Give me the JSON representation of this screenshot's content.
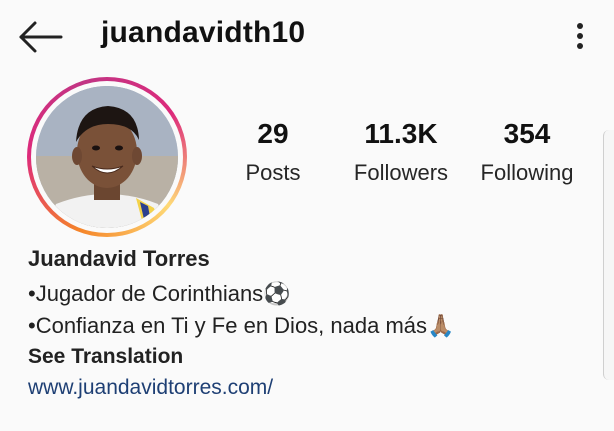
{
  "header": {
    "username": "juandavidth10",
    "back_icon": "arrow-left-icon",
    "more_icon": "more-vertical-icon"
  },
  "profile": {
    "avatar_alt": "profile photo",
    "ring_colors": [
      "#f58529",
      "#dd2a7b",
      "#c13584",
      "#feda77"
    ]
  },
  "stats": [
    {
      "value": "29",
      "label": "Posts"
    },
    {
      "value": "11.3K",
      "label": "Followers"
    },
    {
      "value": "354",
      "label": "Following"
    }
  ],
  "bio": {
    "name": "Juandavid Torres",
    "line1": "•Jugador de Corinthians⚽",
    "line2": "•Confianza en Ti y Fe en Dios, nada más🙏🏽",
    "see_translation": "See Translation",
    "link": "www.juandavidtorres.com/"
  }
}
